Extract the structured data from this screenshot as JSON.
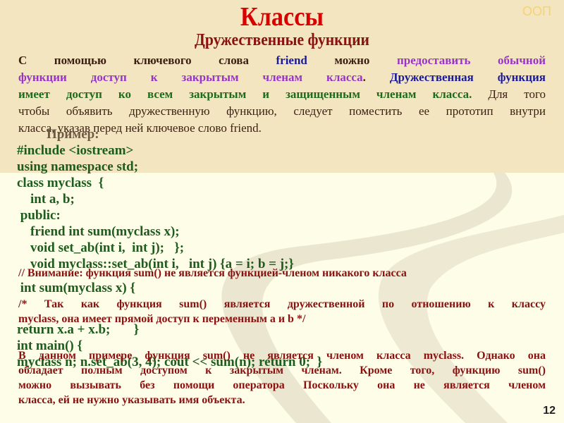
{
  "header": {
    "title": "Классы",
    "subtitle": "Дружественные функции",
    "corner_label": "ООП"
  },
  "intro": {
    "line1": [
      {
        "text": "С помощью ключевого слова ",
        "color": "dark"
      },
      {
        "text": "friend",
        "color": "blue"
      },
      {
        "text": " можно ",
        "color": "dark"
      },
      {
        "text": "предоставить обычной",
        "color": "violet"
      }
    ],
    "line2": [
      {
        "text": "функции доступ к закрытым членам класса",
        "color": "violet"
      },
      {
        "text": ". ",
        "color": "dark"
      },
      {
        "text": "Дружественная функция",
        "color": "blue"
      }
    ],
    "line3": [
      {
        "text": "имеет доступ ко всем закрытым и защищенным членам класса. ",
        "color": "green"
      },
      {
        "text": "Для того",
        "color": "dark"
      }
    ],
    "line4": "чтобы объявить дружественную функцию, следует поместить ее прототип внутри",
    "line5": "класса, указав перед ней ключевое слово friend."
  },
  "example_label": "Пример:",
  "code_block_1": [
    "#include <iostream>",
    "using namespace std;",
    "class myclass  {",
    "    int a, b;",
    " public:",
    "    friend int sum(myclass x);",
    "    void set_ab(int i,  int j);   };",
    "    void myclass::set_ab(int i,   int j) {a = i; b = j;}"
  ],
  "comment_1": "// Внимание: функция sum()  не является функцией-членом никакого класса",
  "code_line_sum": " int sum(myclass x) {",
  "comment_2_line1": "/* Так как функция sum()  является дружественной по отношению к классу",
  "comment_2_line2": "myclass,  она имеет прямой доступ к переменным a и b */",
  "code_block_2": [
    "return x.a + x.b;       }",
    "int main() {",
    "myclass n; n.set_ab(3, 4); cout << sum(n); return 0;  }"
  ],
  "note": {
    "line1": "В данном примере функция sum() не является членом класса myclass. Однако она",
    "line2": "обладает полным доступом к закрытым членам. Кроме того, функцию sum()",
    "line3": "можно вызывать без помощи оператора Поскольку она не является членом",
    "line4": "класса, ей не нужно указывать имя объекта."
  },
  "page_number": "12",
  "colors": {
    "title": "#d90000",
    "subtitle": "#8b1010",
    "code": "#1e5c1e",
    "comment": "#8b1010",
    "keyword_blue": "#1a1a9c",
    "highlight_violet": "#9933cc",
    "bg_top": "#f3e5c0",
    "bg_bottom": "#fdfde8"
  }
}
